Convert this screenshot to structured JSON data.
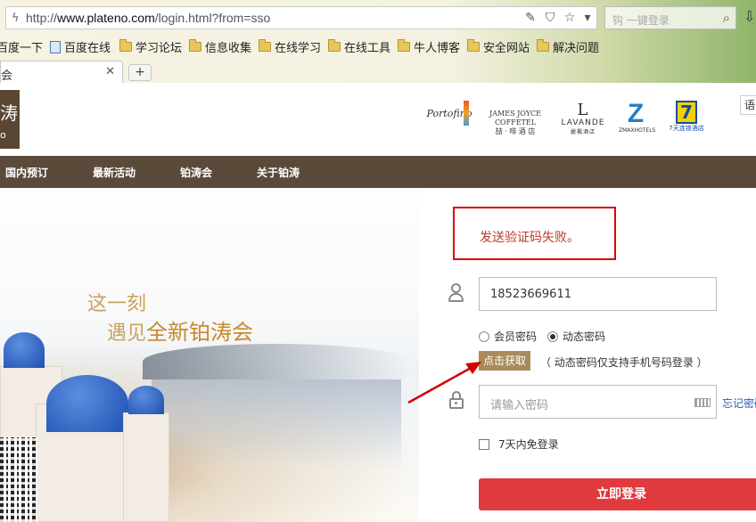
{
  "browser": {
    "url_prefix": "http://",
    "url_host": "www.plateno.com",
    "url_path": "/login.html?from=sso",
    "search_placeholder": "钩  一键登录",
    "tab_title": "会",
    "new_tab_label": "+"
  },
  "bookmarks": [
    {
      "label": "百度一下",
      "icon": "page-icon"
    },
    {
      "label": "百度在线",
      "icon": "page-icon"
    },
    {
      "label": "学习论坛",
      "icon": "folder-icon"
    },
    {
      "label": "信息收集",
      "icon": "folder-icon"
    },
    {
      "label": "在线学习",
      "icon": "folder-icon"
    },
    {
      "label": "在线工具",
      "icon": "folder-icon"
    },
    {
      "label": "牛人博客",
      "icon": "folder-icon"
    },
    {
      "label": "安全网站",
      "icon": "folder-icon"
    },
    {
      "label": "解决问题",
      "icon": "folder-icon"
    }
  ],
  "site": {
    "logo_top": "涛",
    "logo_bottom": "o",
    "brands": {
      "portofino": "Portofino",
      "jj_line1": "JAMES JOYCE",
      "jj_line2": "COFFETEL",
      "jj_line3": "喆 · 啡 酒 店",
      "lavande_big": "L",
      "lavande": "LAVANDE",
      "lavande_sub": "麗楓酒店",
      "zmax_big": "Z",
      "zmax_sub": "ZMAXHOTELS",
      "seven_big": "7",
      "seven_sub": "7天连锁酒店"
    },
    "lang_button": "语",
    "nav": [
      "国内预订",
      "最新活动",
      "铂涛会",
      "关于铂涛"
    ]
  },
  "hero": {
    "line1": "这一刻",
    "line2_prefix": "遇见",
    "line2_em": "全新铂涛会"
  },
  "login": {
    "error_message": "发送验证码失败。",
    "phone_value": "18523669611",
    "radio_member": "会员密码",
    "radio_dynamic": "动态密码",
    "selected": "动态密码",
    "get_code_button": "点击获取",
    "hint": "（ 动态密码仅支持手机号码登录 ）",
    "password_placeholder": "请输入密码",
    "forgot": "忘记密码",
    "remember": "7天内免登录",
    "submit": "立即登录"
  },
  "colors": {
    "nav_bg": "#5a4a3a",
    "error_red": "#c0392b",
    "login_btn": "#e0393e",
    "get_btn": "#a98a5a",
    "annotation": "#d00000"
  }
}
